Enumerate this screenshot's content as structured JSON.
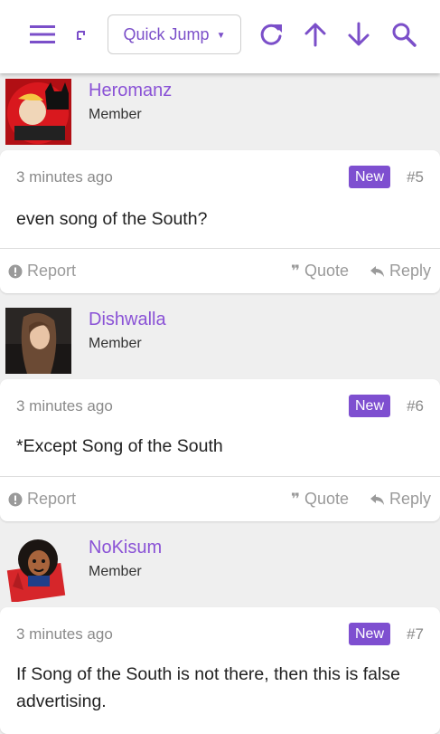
{
  "toolbar": {
    "menu_icon": "hamburger-menu-icon",
    "small_icon": "edit-icon",
    "quick_jump_label": "Quick Jump",
    "refresh_icon": "refresh-icon",
    "up_icon": "arrow-up-icon",
    "down_icon": "arrow-down-icon",
    "search_icon": "search-icon",
    "accent_color": "#7b4fc9"
  },
  "posts": [
    {
      "username": "Heromanz",
      "role": "Member",
      "time": "3 minutes ago",
      "badge": "New",
      "number": "#5",
      "text": "even song of the South?",
      "report_label": "Report",
      "quote_label": "Quote",
      "reply_label": "Reply"
    },
    {
      "username": "Dishwalla",
      "role": "Member",
      "time": "3 minutes ago",
      "badge": "New",
      "number": "#6",
      "text": "*Except Song of the South",
      "report_label": "Report",
      "quote_label": "Quote",
      "reply_label": "Reply"
    },
    {
      "username": "NoKisum",
      "role": "Member",
      "time": "3 minutes ago",
      "badge": "New",
      "number": "#7",
      "text": "If Song of the South is not there, then this is false advertising."
    }
  ]
}
